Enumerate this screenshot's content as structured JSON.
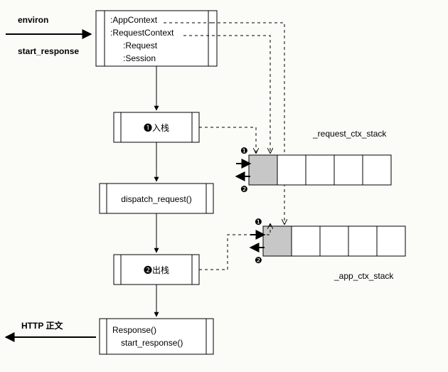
{
  "inputs": {
    "environ": "environ",
    "start_response": "start_response"
  },
  "box_context": {
    "app": ":AppContext",
    "req": ":RequestContext",
    "request": ":Request",
    "session": ":Session"
  },
  "steps": {
    "push": "❶入栈",
    "dispatch": "dispatch_request()",
    "pop": "❷出栈",
    "response1": "Response()",
    "response2": "start_response()"
  },
  "stacks": {
    "request_label": "_request_ctx_stack",
    "app_label": "_app_ctx_stack",
    "marker_in": "❶",
    "marker_out": "❷"
  },
  "output": {
    "http_body": "HTTP 正文"
  }
}
